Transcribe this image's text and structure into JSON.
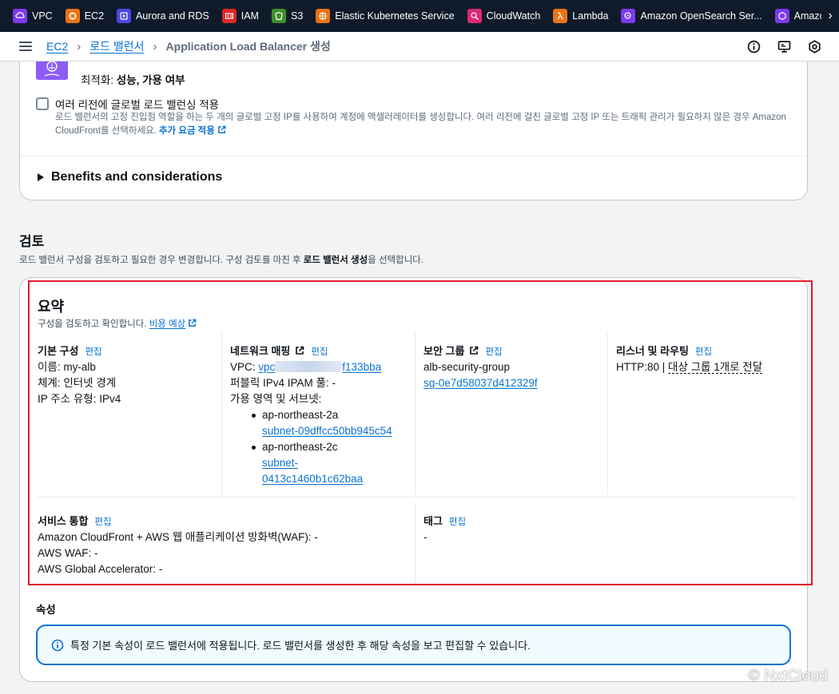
{
  "favorites": [
    {
      "label": "VPC",
      "icon": "vpc-icon",
      "color": "#7c3aed"
    },
    {
      "label": "EC2",
      "icon": "ec2-icon",
      "color": "#ea7316"
    },
    {
      "label": "Aurora and RDS",
      "icon": "rds-icon",
      "color": "#4f46e5"
    },
    {
      "label": "IAM",
      "icon": "iam-icon",
      "color": "#dc2626"
    },
    {
      "label": "S3",
      "icon": "s3-icon",
      "color": "#3f8f2b"
    },
    {
      "label": "Elastic Kubernetes Service",
      "icon": "eks-icon",
      "color": "#ea7316"
    },
    {
      "label": "CloudWatch",
      "icon": "cloudwatch-icon",
      "color": "#db2777"
    },
    {
      "label": "Lambda",
      "icon": "lambda-icon",
      "color": "#ea7316"
    },
    {
      "label": "Amazon OpenSearch Ser...",
      "icon": "opensearch-icon",
      "color": "#7c3aed"
    },
    {
      "label": "Amazon Sa",
      "icon": "sagemaker-icon",
      "color": "#7c3aed"
    }
  ],
  "breadcrumb": {
    "ec2": "EC2",
    "lb": "로드 밸런서",
    "current": "Application Load Balancer 생성"
  },
  "top_panel": {
    "optimization_prefix": "최적화:",
    "optimization_value": "성능, 가용 여부",
    "global_checkbox_label": "여러 리전에 글로벌 로드 밸런싱 적용",
    "global_checkbox_desc": "로드 밸런서의 고정 진입점 역할을 하는 두 개의 글로벌 고정 IP를 사용하여 계정에 액셀러레이터를 생성합니다. 여러 리전에 걸친 글로벌 고정 IP 또는 트래픽 관리가 필요하지 않은 경우 Amazon CloudFront를 선택하세요.",
    "extra_charge_link": "추가 요금 적용",
    "benefits": "Benefits and considerations"
  },
  "review": {
    "title": "검토",
    "desc_prefix": "로드 밸런서 구성을 검토하고 필요한 경우 변경합니다. 구성 검토를 마친 후 ",
    "desc_bold": "로드 밸런서 생성",
    "desc_suffix": "을 선택합니다."
  },
  "summary": {
    "title": "요약",
    "desc": "구성을 검토하고 확인합니다.",
    "cost_link": "비용 예상",
    "edit_label": "편집",
    "basic": {
      "heading": "기본 구성",
      "name": "이름: my-alb",
      "scheme": "체계: 인터넷 경계",
      "ip_type": "IP 주소 유형: IPv4"
    },
    "network": {
      "heading": "네트워크 매핑",
      "vpc_label": "VPC:",
      "vpc_prefix": "vpc",
      "vpc_suffix": "f133bba",
      "ipam": "퍼블릭 IPv4 IPAM 풀: -",
      "az_label": "가용 영역 및 서브넷:",
      "az1": "ap-northeast-2a",
      "subnet1": "subnet-09dffcc50bb945c54",
      "az2": "ap-northeast-2c",
      "subnet2_a": "subnet-",
      "subnet2_b": "0413c1460b1c62baa"
    },
    "security": {
      "heading": "보안 그룹",
      "group_name": "alb-security-group",
      "group_id": "sg-0e7d58037d412329f"
    },
    "listener": {
      "heading": "리스너 및 라우팅",
      "value_prefix": "HTTP:80 | ",
      "value_target": "대상 그룹 1개로 전달"
    },
    "services": {
      "heading": "서비스 통합",
      "cloudfront": "Amazon CloudFront + AWS 웹 애플리케이션 방화벽(WAF): -",
      "waf": "AWS WAF: -",
      "accelerator": "AWS Global Accelerator: -"
    },
    "tags": {
      "heading": "태그",
      "value": "-"
    }
  },
  "attributes": {
    "title": "속성",
    "info": "특정 기본 속성이 로드 밸런서에 적용됩니다. 로드 밸런서를 생성한 후 해당 속성을 보고 편집할 수 있습니다."
  },
  "watermark": "© NxtCloud"
}
